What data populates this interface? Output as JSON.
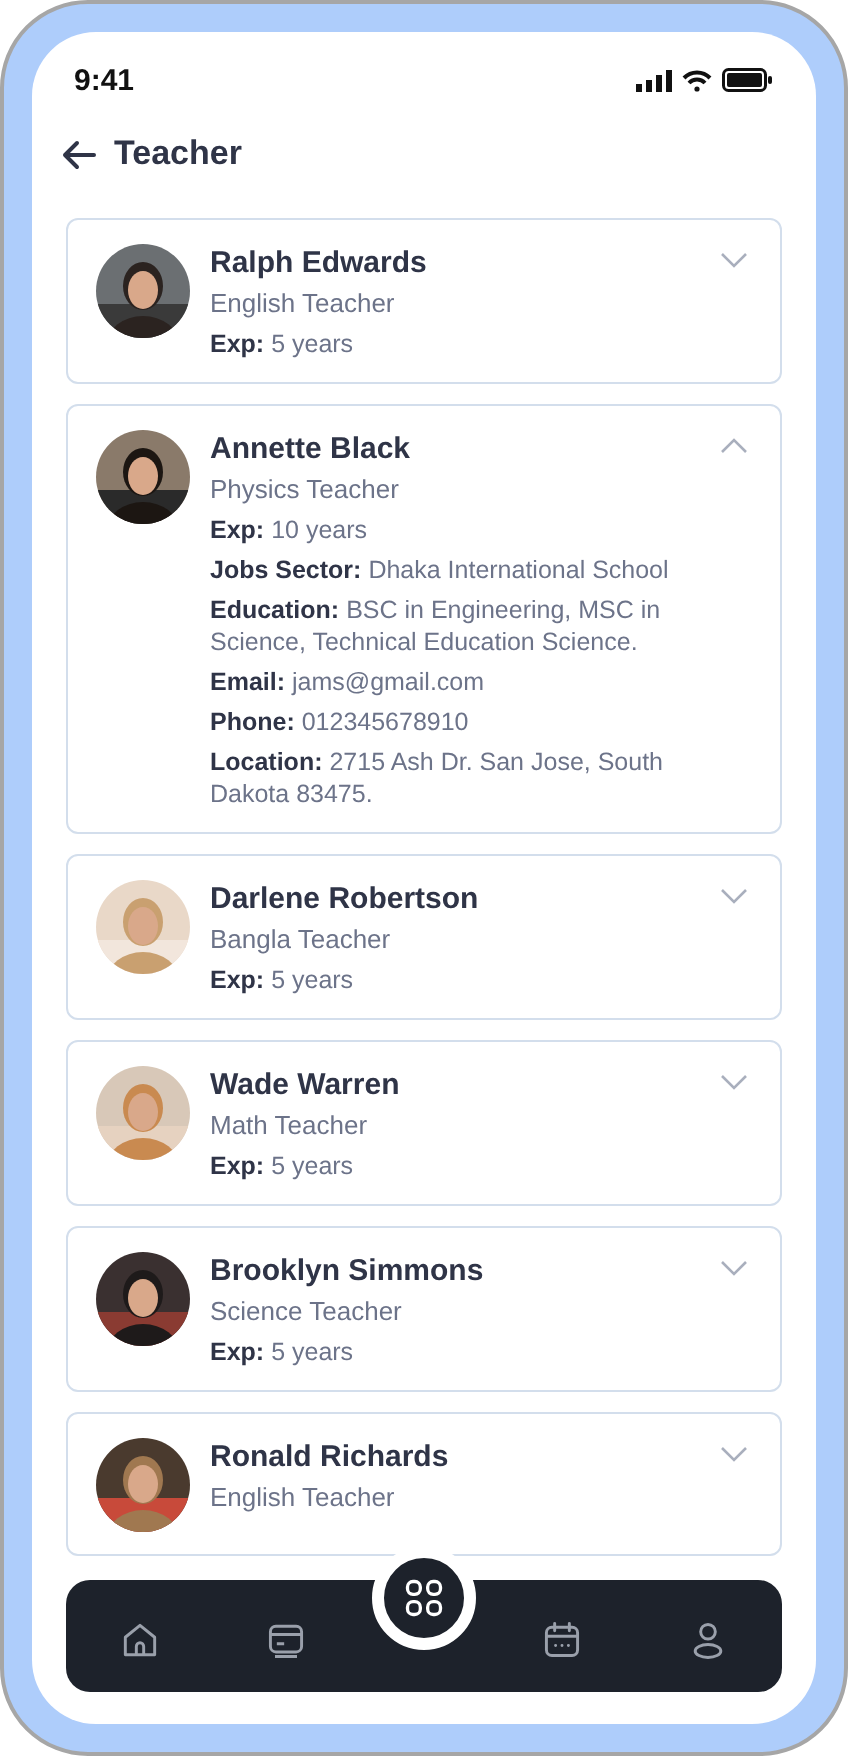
{
  "status_bar": {
    "time": "9:41"
  },
  "header": {
    "title": "Teacher"
  },
  "teachers": [
    {
      "name": "Ralph Edwards",
      "role": "English Teacher",
      "expanded": false,
      "details": [
        "**Exp:** 5 years"
      ]
    },
    {
      "name": "Annette Black",
      "role": "Physics Teacher",
      "expanded": true,
      "details": [
        "**Exp:** 10 years",
        "**Jobs Sector:** Dhaka International School",
        "**Education:** BSC in Engineering, MSC in Science, Technical Education Science.",
        "**Email:** jams@gmail.com",
        "**Phone:** 012345678910",
        "**Location:** 2715 Ash Dr. San Jose, South Dakota 83475."
      ]
    },
    {
      "name": "Darlene Robertson",
      "role": "Bangla Teacher",
      "expanded": false,
      "details": [
        "**Exp:** 5 years"
      ]
    },
    {
      "name": "Wade Warren",
      "role": "Math Teacher",
      "expanded": false,
      "details": [
        "**Exp:** 5 years"
      ]
    },
    {
      "name": "Brooklyn Simmons",
      "role": "Science Teacher",
      "expanded": false,
      "details": [
        "**Exp:** 5 years"
      ]
    },
    {
      "name": "Ronald Richards",
      "role": "English Teacher",
      "expanded": false
    }
  ],
  "nav": [
    {
      "kind": "home",
      "selected": false
    },
    {
      "kind": "card",
      "selected": false
    },
    {
      "kind": "grid",
      "selected": true
    },
    {
      "kind": "calendar",
      "selected": false
    },
    {
      "kind": "user",
      "selected": false
    }
  ]
}
